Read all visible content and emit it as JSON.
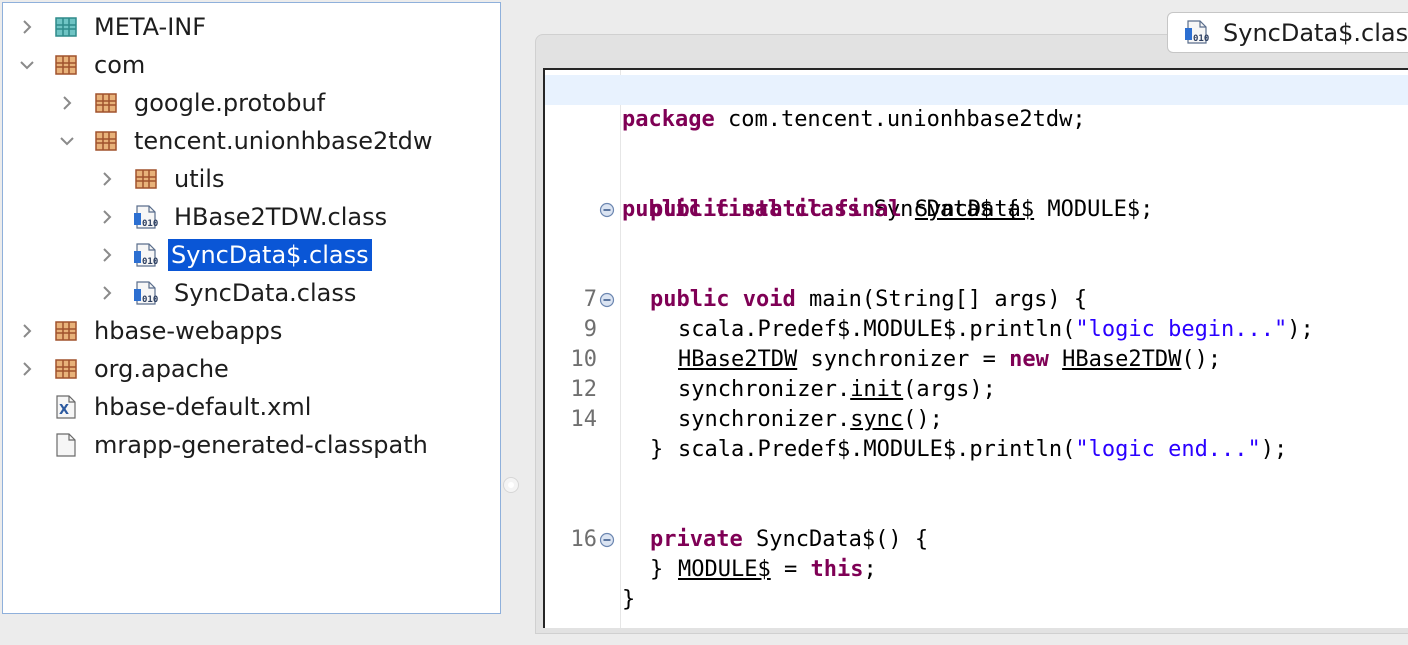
{
  "tree": {
    "items": [
      {
        "label": "META-INF",
        "icon": "package-folder-icon",
        "twisty": "collapsed"
      },
      {
        "label": "com",
        "icon": "package-icon",
        "twisty": "expanded"
      },
      {
        "label": "google.protobuf",
        "icon": "package-icon",
        "twisty": "collapsed"
      },
      {
        "label": "tencent.unionhbase2tdw",
        "icon": "package-icon",
        "twisty": "expanded"
      },
      {
        "label": "utils",
        "icon": "package-icon",
        "twisty": "collapsed"
      },
      {
        "label": "HBase2TDW.class",
        "icon": "class-file-icon",
        "twisty": "collapsed"
      },
      {
        "label": "SyncData$.class",
        "icon": "class-file-icon",
        "twisty": "collapsed",
        "selected": true
      },
      {
        "label": "SyncData.class",
        "icon": "class-file-icon",
        "twisty": "collapsed"
      },
      {
        "label": "hbase-webapps",
        "icon": "package-icon",
        "twisty": "collapsed"
      },
      {
        "label": "org.apache",
        "icon": "package-icon",
        "twisty": "collapsed"
      },
      {
        "label": "hbase-default.xml",
        "icon": "xml-file-icon",
        "twisty": "none"
      },
      {
        "label": "mrapp-generated-classpath",
        "icon": "file-icon",
        "twisty": "none"
      }
    ]
  },
  "editor": {
    "tab_label": "SyncData$.class",
    "line_numbers": [
      "7",
      "9",
      "10",
      "12",
      "14",
      "16"
    ],
    "code": {
      "l1_kw": "package",
      "l1_rest": " com.tencent.unionhbase2tdw;",
      "l2_kw": "public final class",
      "l2_rest": " SyncData$ {",
      "l3_kw": "public static final",
      "l3_type": "SyncData$",
      "l3_rest": " MODULE$;",
      "l4_kw": "public void",
      "l4_rest": " main(String[] args) {",
      "l5_pre": "scala.Predef$.MODULE$.println(",
      "l5_str": "\"logic begin...\"",
      "l5_post": ");",
      "l6_type": "HBase2TDW",
      "l6_mid": " synchronizer = ",
      "l6_kw": "new",
      "l6_sp": " ",
      "l6_type2": "HBase2TDW",
      "l6_post": "();",
      "l7_pre": "synchronizer.",
      "l7_m": "init",
      "l7_post": "(args);",
      "l8_pre": "synchronizer.",
      "l8_m": "sync",
      "l8_post": "();",
      "l9_pre": "scala.Predef$.MODULE$.println(",
      "l9_str": "\"logic end...\"",
      "l9_post": ");",
      "l10": "}",
      "l11_kw": "private",
      "l11_rest": " SyncData$() {",
      "l12_field": "MODULE$",
      "l12_mid": " = ",
      "l12_kw": "this",
      "l12_post": ";",
      "l13": "}",
      "l14": "}"
    }
  },
  "colors": {
    "selection": "#0a56d6",
    "keyword": "#7f0055",
    "string": "#2a00ff",
    "current_line": "#e8f2fe"
  }
}
